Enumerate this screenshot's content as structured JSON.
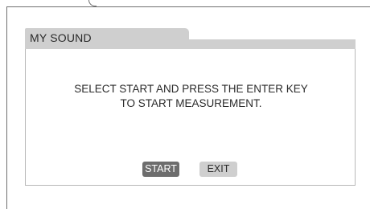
{
  "dialog": {
    "title": "MY SOUND",
    "message_line1": "SELECT START AND PRESS THE ENTER KEY",
    "message_line2": "TO START MEASUREMENT."
  },
  "buttons": {
    "start_label": "START",
    "exit_label": "EXIT"
  },
  "colors": {
    "tab_gray": "#cfcfcf",
    "selected_button": "#6d6d6d",
    "text": "#2a2a2a"
  }
}
